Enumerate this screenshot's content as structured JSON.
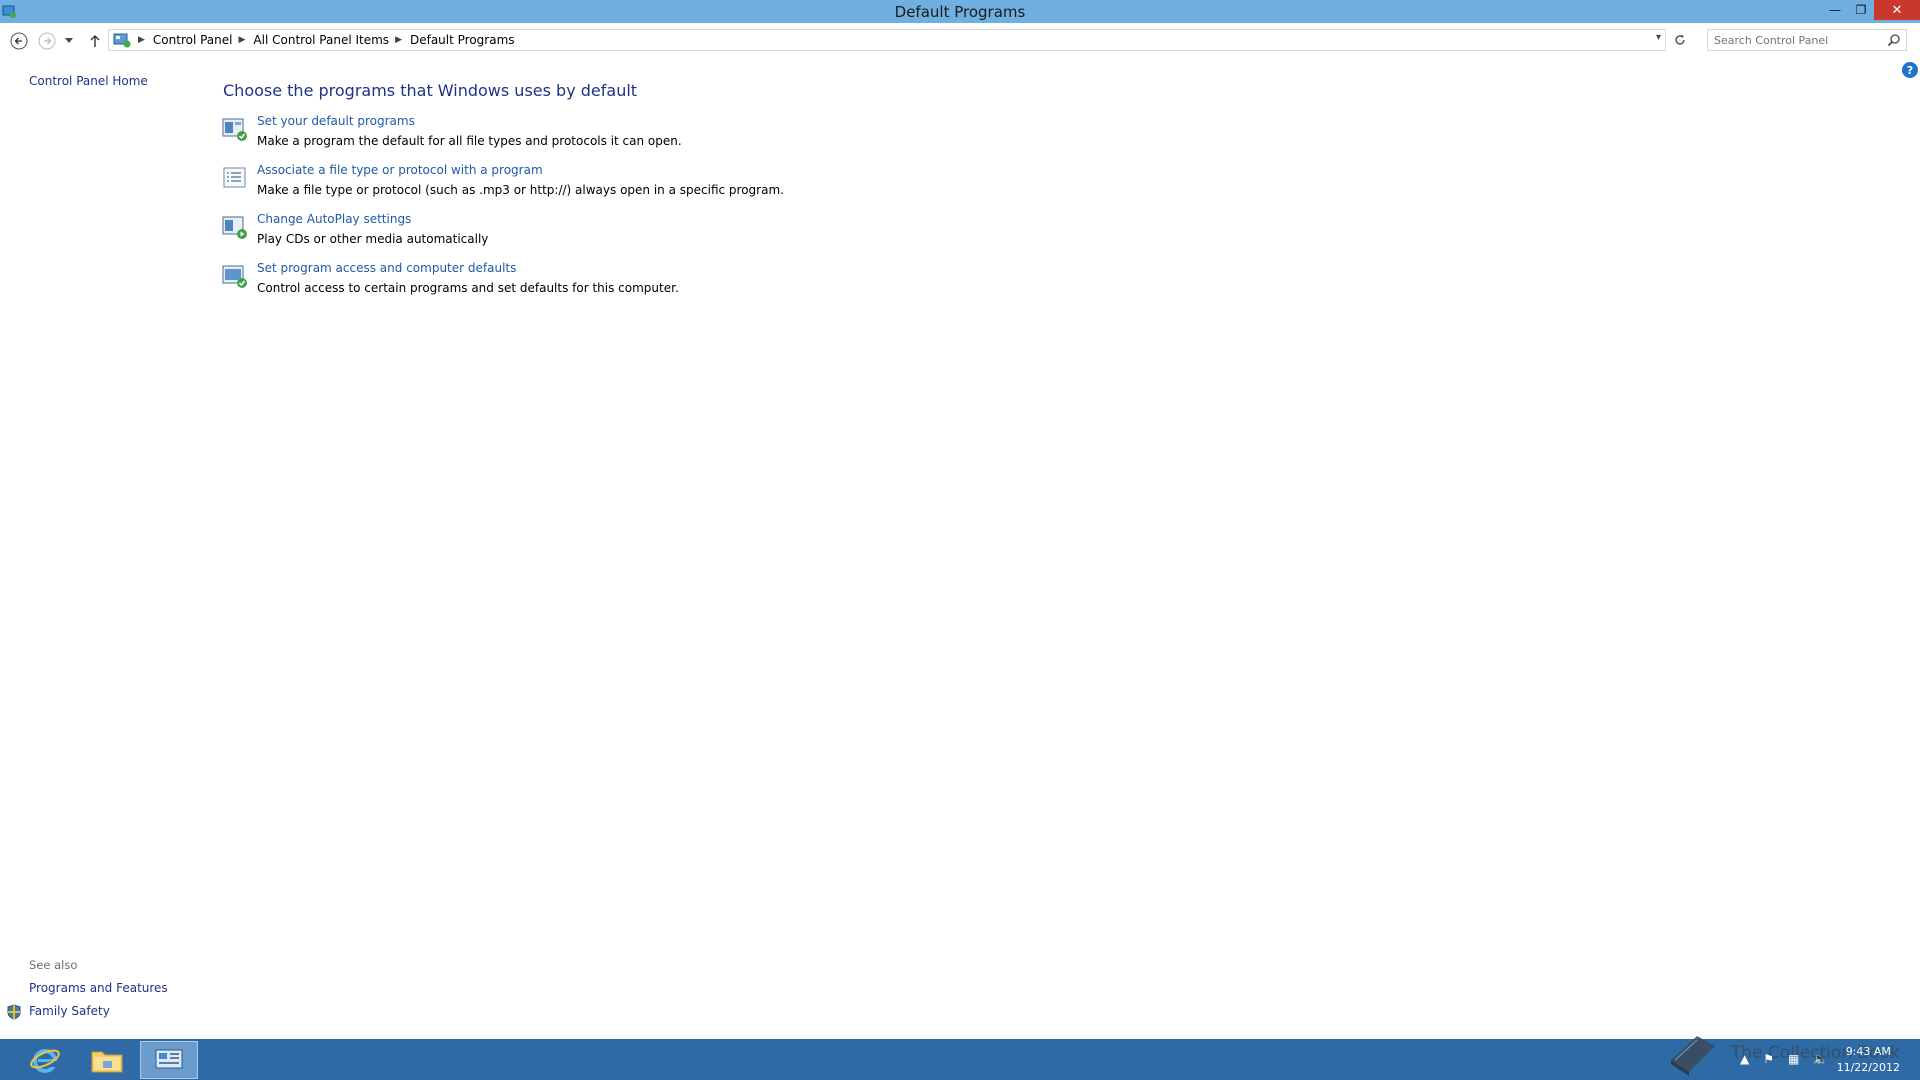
{
  "window": {
    "title": "Default Programs",
    "controls": {
      "minimize": "—",
      "restore": "❐",
      "close": "✕"
    }
  },
  "nav": {
    "breadcrumbs": [
      "Control Panel",
      "All Control Panel Items",
      "Default Programs"
    ],
    "search_placeholder": "Search Control Panel"
  },
  "sidebar": {
    "home_label": "Control Panel Home",
    "see_also_label": "See also",
    "see_also_links": [
      "Programs and Features",
      "Family Safety"
    ]
  },
  "main": {
    "title": "Choose the programs that Windows uses by default",
    "tasks": [
      {
        "link": "Set your default programs",
        "desc": "Make a program the default for all file types and protocols it can open.",
        "icon": "default-programs-icon"
      },
      {
        "link": "Associate a file type or protocol with a program",
        "desc": "Make a file type or protocol (such as .mp3 or http://) always open in a specific program.",
        "icon": "file-association-icon"
      },
      {
        "link": "Change AutoPlay settings",
        "desc": "Play CDs or other media automatically",
        "icon": "autoplay-icon"
      },
      {
        "link": "Set program access and computer defaults",
        "desc": "Control access to certain programs and set defaults for this computer.",
        "icon": "program-access-icon"
      }
    ]
  },
  "taskbar": {
    "watermark": "The Collection Book",
    "clock_time": "9:43 AM",
    "clock_date": "11/22/2012"
  },
  "colors": {
    "titlebar": "#6fb0e0",
    "taskbar": "#2d6aa6",
    "link": "#1e5aa8",
    "heading": "#1e3287"
  }
}
